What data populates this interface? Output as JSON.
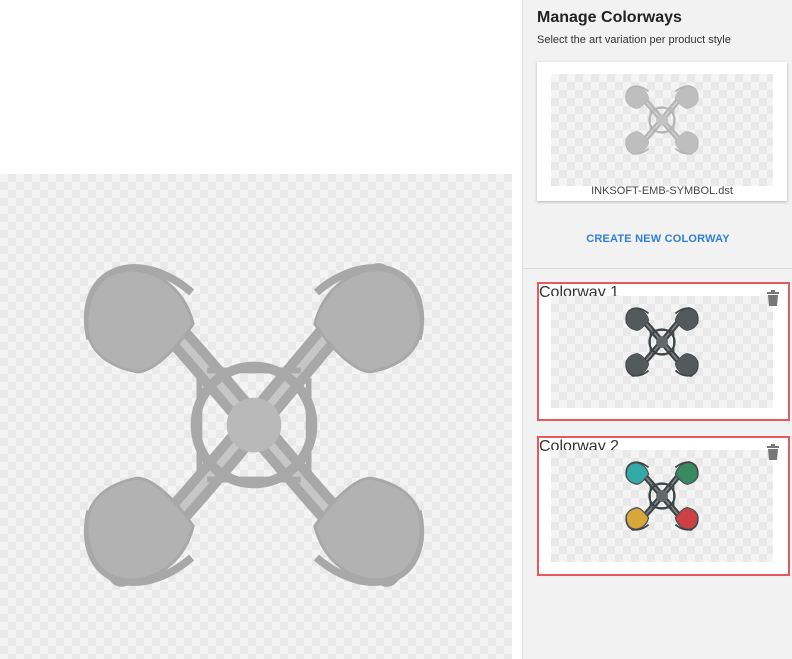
{
  "panel": {
    "title": "Manage Colorways",
    "subtitle": "Select the art variation per product style"
  },
  "source_art": {
    "filename": "INKSOFT-EMB-SYMBOL.dst",
    "color": "#b5b5b5"
  },
  "create_button": "CREATE NEW COLORWAY",
  "colorways": [
    {
      "label": "Colorway 1",
      "colors": {
        "frame": "#3d4446",
        "top_left": "#3d4446",
        "top_right": "#3d4446",
        "bottom_left": "#3d4446",
        "bottom_right": "#3d4446"
      }
    },
    {
      "label": "Colorway 2",
      "colors": {
        "frame": "#3d4446",
        "top_left": "#1a9e9c",
        "top_right": "#1a7a4a",
        "bottom_left": "#d49a1e",
        "bottom_right": "#c8262a"
      }
    }
  ],
  "icons": {
    "delete": "trash-icon"
  },
  "canvas": {
    "design_color": "#a8a8a8"
  }
}
